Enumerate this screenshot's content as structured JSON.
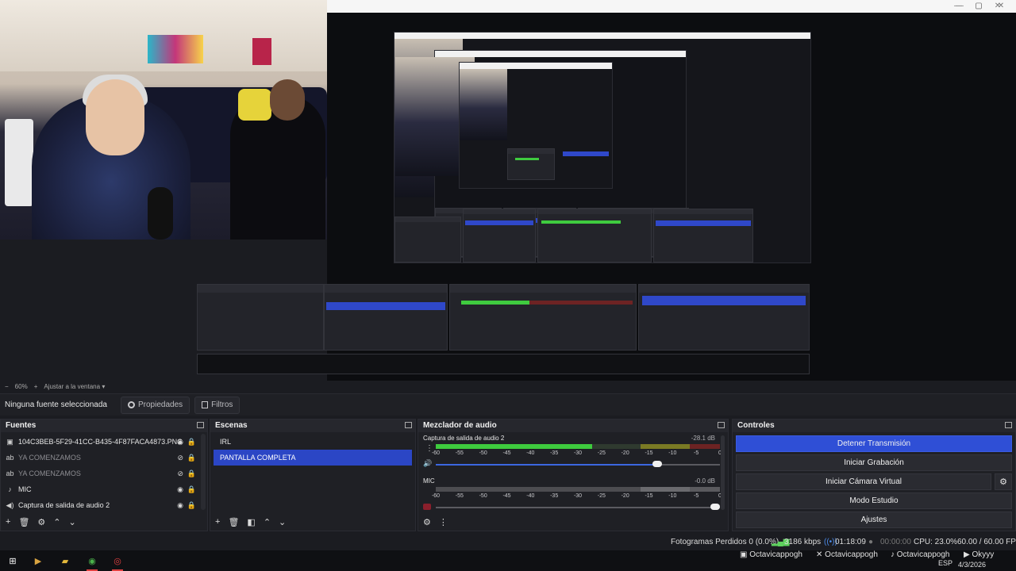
{
  "preview": {
    "nested_fuentes": [
      "104C3BEB-5F29-41CC-B435-4F87FACA4873.PNG",
      "YA COMENZAMOS",
      "YA COMENZAMOS",
      "MIC",
      "Captura de salida de audio 2"
    ],
    "nested_escenas": [
      "IRL",
      "PANTALLA COMPLETA"
    ],
    "nested_controles": [
      "Detener Transmisión",
      "Iniciar Grabación",
      "Iniciar Cámara Virtual",
      "Modo Estudio",
      "Ajustes"
    ],
    "nested_status": "Fotogramas Perdidos 0 (0.0%)   3186 kbps   01:18:09   00:00:00   CPU: 23.0%   60.00 / 60.00 FPS"
  },
  "zoom": {
    "minus": "−",
    "value": "60%",
    "plus": "+",
    "fit": "Ajustar a la ventana"
  },
  "context": {
    "selection": "Ninguna fuente seleccionada",
    "properties": "Propiedades",
    "filters": "Filtros"
  },
  "fuentes": {
    "title": "Fuentes",
    "items": [
      {
        "label": "104C3BEB-5F29-41CC-B435-4F87FACA4873.PNG",
        "icon": "image-icon",
        "visible": true
      },
      {
        "label": "YA COMENZAMOS",
        "icon": "text-icon",
        "visible": false
      },
      {
        "label": "YA COMENZAMOS",
        "icon": "text-icon",
        "visible": false
      },
      {
        "label": "MIC",
        "icon": "mic-icon",
        "visible": true
      },
      {
        "label": "Captura de salida de audio 2",
        "icon": "speaker-icon",
        "visible": true
      }
    ]
  },
  "escenas": {
    "title": "Escenas",
    "items": [
      {
        "label": "IRL",
        "selected": false
      },
      {
        "label": "PANTALLA COMPLETA",
        "selected": true
      }
    ]
  },
  "mixer": {
    "title": "Mezclador de audio",
    "ticks": [
      "-60",
      "-55",
      "-50",
      "-45",
      "-40",
      "-35",
      "-30",
      "-25",
      "-20",
      "-15",
      "-10",
      "-5",
      "0"
    ],
    "channels": [
      {
        "name": "Captura de salida de audio 2",
        "db": "-28.1 dB",
        "level_fraction": 0.55,
        "volume_fraction": 0.78,
        "muted": false
      },
      {
        "name": "MIC",
        "db": "-0.0 dB",
        "level_fraction": 0,
        "volume_fraction": 1.0,
        "muted": true
      }
    ]
  },
  "controles": {
    "title": "Controles",
    "buttons": [
      "Detener Transmisión",
      "Iniciar Grabación",
      "Iniciar Cámara Virtual",
      "Modo Estudio",
      "Ajustes"
    ]
  },
  "status": {
    "dropped": "Fotogramas Perdidos 0 (0.0%)",
    "bitrate": "3186 kbps",
    "live_time": "01:18:09",
    "rec_time": "00:00:00",
    "cpu": "CPU: 23.0%",
    "fps": "60.00 / 60.00 FPS",
    "accent_color": "#2f4fd6"
  },
  "taskbar": {
    "users": [
      "Octavicappogh",
      "Octavicappogh",
      "Octavicappogh",
      "Okyyy"
    ],
    "lang": "ESP",
    "date": "4/3/2026"
  }
}
